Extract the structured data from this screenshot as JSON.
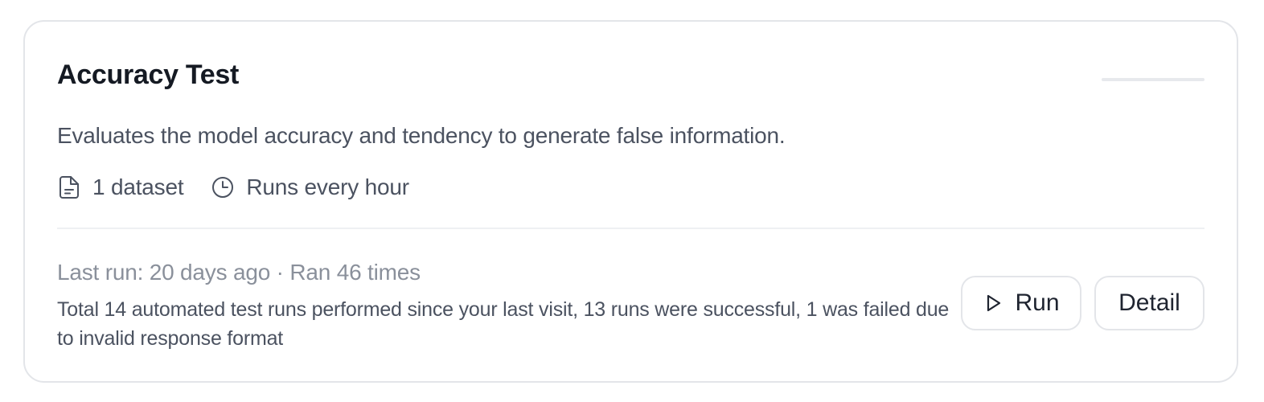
{
  "card": {
    "title": "Accuracy Test",
    "description": "Evaluates the model accuracy and tendency to generate false information.",
    "meta": {
      "dataset_icon": "file-text-icon",
      "dataset_label": "1 dataset",
      "schedule_icon": "clock-icon",
      "schedule_label": "Runs every hour"
    },
    "last_run": "Last run: 20 days ago · Ran 46 times",
    "summary": "Total 14 automated test runs performed since your last visit, 13 runs were successful, 1 was failed due to invalid response format",
    "actions": {
      "run_icon": "play-icon",
      "run_label": "Run",
      "detail_label": "Detail"
    }
  },
  "colors": {
    "title": "#151a23",
    "body_text": "#4b5260",
    "muted_text": "#8a909b",
    "border": "#e3e5e9"
  }
}
